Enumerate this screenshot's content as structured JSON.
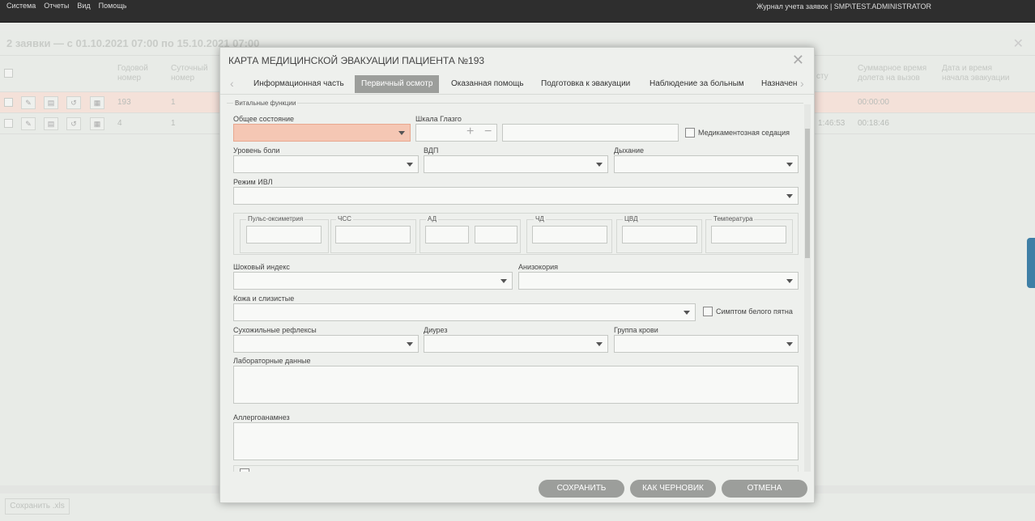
{
  "topbar": {
    "menu": [
      "Система",
      "Отчеты",
      "Вид",
      "Помощь"
    ],
    "right_text": "Журнал учета заявок | SMP\\TEST.ADMINISTRATOR"
  },
  "background": {
    "title": "2 заявки — с 01.10.2021 07:00 по 15.10.2021 07:00",
    "columns": [
      "Годовой номер",
      "Суточный номер",
      "Суммарное время долета на вызов",
      "Дата и время начала эвакуации"
    ],
    "partial_col": "стy",
    "rows": [
      {
        "annual": "193",
        "daily": "1",
        "time": "",
        "total": "00:00:00"
      },
      {
        "annual": "4",
        "daily": "1",
        "time": "1:46:53",
        "total": "00:18:46"
      }
    ],
    "export_button": "Сохранить .xls"
  },
  "modal": {
    "title": "КАРТА МЕДИЦИНСКОЙ ЭВАКУАЦИИ ПАЦИЕНТА №193",
    "tabs": [
      "Информационная часть",
      "Первичный осмотр",
      "Оказанная помощь",
      "Подготовка к эвакуации",
      "Наблюдение за больным",
      "Назначен"
    ],
    "active_tab": "Первичный осмотр",
    "section": "Витальные функции",
    "fields": {
      "general_state": "Общее состояние",
      "glasgow": "Шкала Глазго",
      "sedation": "Медикаментозная седация",
      "pain": "Уровень боли",
      "vdp": "ВДП",
      "breathing": "Дыхание",
      "ivl": "Режим ИВЛ",
      "pulse_ox": "Пульс-оксиметрия",
      "hr": "ЧСС",
      "bp": "АД",
      "rr": "ЧД",
      "cvp": "ЦВД",
      "temp": "Температура",
      "shock": "Шоковый индекс",
      "anisocoria": "Анизокория",
      "skin": "Кожа и слизистые",
      "white_spot": "Симптом белого пятна",
      "reflexes": "Сухожильные рефлексы",
      "diuresis": "Диурез",
      "blood": "Группа крови",
      "lab": "Лабораторные данные",
      "allergy": "Аллергоанамнез"
    },
    "buttons": {
      "save": "СОХРАНИТЬ",
      "draft": "КАК ЧЕРНОВИК",
      "cancel": "ОТМЕНА"
    }
  }
}
